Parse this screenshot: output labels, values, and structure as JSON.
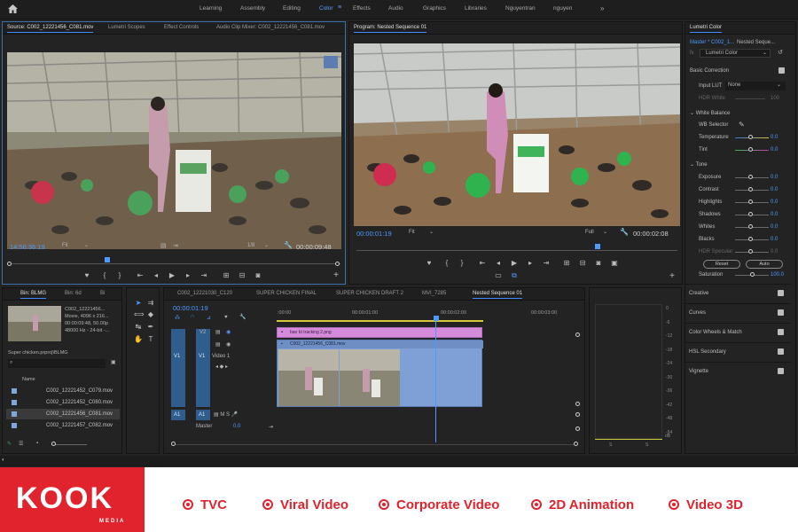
{
  "workspaces": [
    "Learning",
    "Assembly",
    "Editing",
    "Color",
    "Effects",
    "Audio",
    "Graphics",
    "Libraries",
    "Nguyentran",
    "nguyen"
  ],
  "active_workspace": "Color",
  "source_panel": {
    "tabs": [
      "Source: C002_12221456_C081.mov",
      "Lumetri Scopes",
      "Effect Controls",
      "Audio Clip Mixer: C002_12221456_C081.mov"
    ],
    "timecode": "14:56:36:19",
    "fit": "Fit",
    "resolution": "1/8",
    "duration": "00:00:09:48"
  },
  "program_panel": {
    "tab": "Program: Nested Sequence 01",
    "timecode": "00:00:01:19",
    "fit": "Fit",
    "resolution": "Full",
    "duration": "00:00:02:08"
  },
  "lumetri": {
    "title": "Lumetri Color",
    "master": "Master * C002_1...",
    "sequence": "Nested Seque...",
    "effect": "Lumetri Color",
    "basic_correction": "Basic Correction",
    "input_lut_label": "Input LUT",
    "input_lut_value": "None",
    "hdr_white_label": "HDR White",
    "hdr_white_value": "100",
    "white_balance": "White Balance",
    "wb_selector": "WB Selector",
    "tone": "Tone",
    "sliders": [
      {
        "label": "Temperature",
        "value": "0.0",
        "position": 0.45
      },
      {
        "label": "Tint",
        "value": "0.0",
        "position": 0.45
      },
      {
        "label": "Exposure",
        "value": "0.0",
        "position": 0.45
      },
      {
        "label": "Contrast",
        "value": "0.0",
        "position": 0.45
      },
      {
        "label": "Highlights",
        "value": "0.0",
        "position": 0.45
      },
      {
        "label": "Shadows",
        "value": "0.0",
        "position": 0.45
      },
      {
        "label": "Whites",
        "value": "0.0",
        "position": 0.45
      },
      {
        "label": "Blacks",
        "value": "0.0",
        "position": 0.45
      },
      {
        "label": "HDR Specular",
        "value": "0.0",
        "position": 0.45
      }
    ],
    "reset_button": "Reset",
    "auto_button": "Auto",
    "saturation_label": "Saturation",
    "saturation_value": "100.0",
    "sections": [
      "Creative",
      "Curves",
      "Color Wheels & Match",
      "HSL Secondary",
      "Vignette"
    ]
  },
  "project_panel": {
    "tabs": [
      "Bin: BLMG",
      "Bin: 6d",
      "Bi"
    ],
    "clip_name": "C002_12221456...",
    "clip_info": [
      "Movie, 4096 x 216...",
      "00:00:09:48, 50.00p",
      "48000 Hz - 24-bit -..."
    ],
    "project_path": "Super chicken.prproj\\BLMG",
    "name_header": "Name",
    "files": [
      "C002_12221452_C079.mov",
      "C002_12221452_C080.mov",
      "C002_12221456_C081.mov",
      "C002_12221457_C082.mov"
    ]
  },
  "timeline": {
    "tabs": [
      "C002_12221030_C120",
      "SUPER CHICKEN FINAL",
      "SUPER CHICKEN DRAFT 2",
      "MVI_7285",
      "Nested Sequence 01"
    ],
    "timecode": "00:00:01:19",
    "ruler": [
      ":00:00",
      "00:00:01:00",
      "00:00:02:00",
      "00:00:03:00"
    ],
    "tracks": {
      "v2": "V2",
      "v1": "V1",
      "a1": "A1",
      "video1": "Video 1",
      "master": "Master",
      "master_value": "0.0"
    },
    "clips": {
      "graphic": "bao bì tracking 2.png",
      "video": "C002_12221456_C081.mov"
    }
  },
  "audio_meter": {
    "scale": [
      "0",
      "-6",
      "-12",
      "-18",
      "-24",
      "-30",
      "-36",
      "-42",
      "-48",
      "-54"
    ],
    "bottom": "dB",
    "solo_left": "S",
    "solo_right": "S"
  },
  "banner": {
    "logo": "KOOK",
    "logo_sub": "MEDIA",
    "items": [
      "TVC",
      "Viral Video",
      "Corporate Video",
      "2D  Animation",
      "Video 3D"
    ],
    "color": "#e0232d"
  }
}
